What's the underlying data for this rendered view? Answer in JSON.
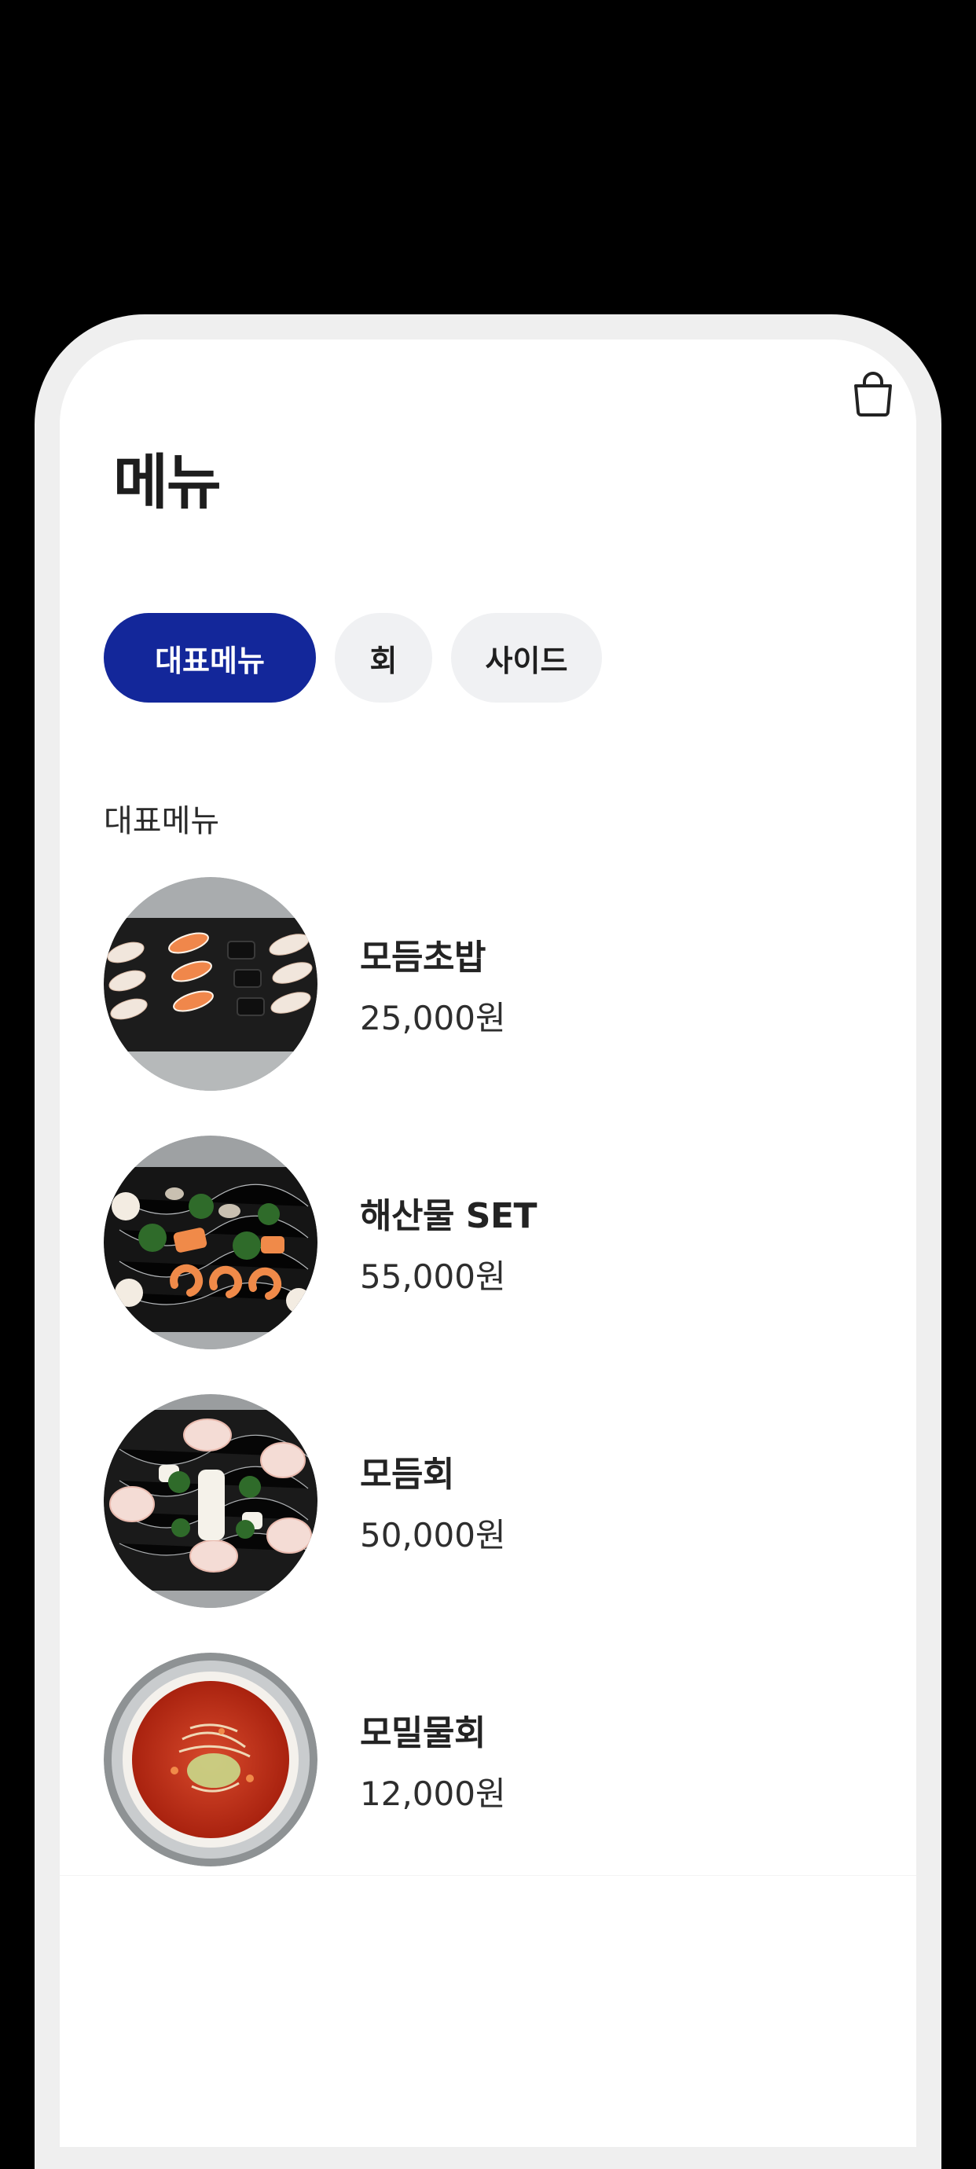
{
  "header": {
    "title": "메뉴",
    "cart_icon": "shopping-bag-icon"
  },
  "tabs": [
    {
      "label": "대표메뉴",
      "active": true
    },
    {
      "label": "회",
      "active": false
    },
    {
      "label": "사이드",
      "active": false
    }
  ],
  "section": {
    "title": "대표메뉴"
  },
  "menu_items": [
    {
      "name": "모듬초밥",
      "price": "25,000원",
      "image": "assorted-sushi-platter"
    },
    {
      "name": "해산물 SET",
      "price": "55,000원",
      "image": "seafood-platter"
    },
    {
      "name": "모듬회",
      "price": "50,000원",
      "image": "assorted-sashimi-platter"
    },
    {
      "name": "모밀물회",
      "price": "12,000원",
      "image": "spicy-cold-raw-fish-soup-bowl"
    }
  ],
  "colors": {
    "accent": "#13279a",
    "tab_inactive_bg": "#f0f1f3",
    "background": "#ffffff",
    "frame": "#efefef"
  }
}
